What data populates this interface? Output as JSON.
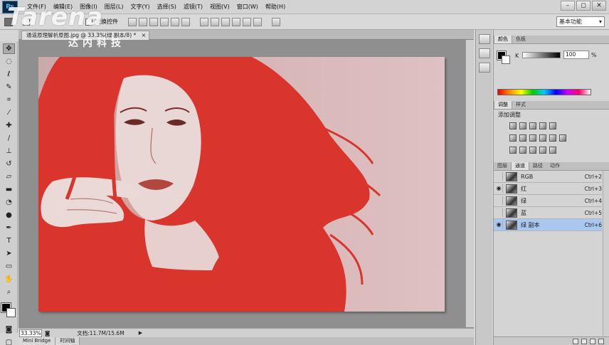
{
  "app": {
    "logo_text": "Ps",
    "menu": [
      "文件(F)",
      "编辑(E)",
      "图像(I)",
      "图层(L)",
      "文字(Y)",
      "选择(S)",
      "滤镜(T)",
      "视图(V)",
      "窗口(W)",
      "帮助(H)"
    ],
    "window_controls": [
      "–",
      "◻",
      "✕"
    ]
  },
  "watermark": {
    "logo": "Tarena",
    "subtitle": "达内科技"
  },
  "options_bar": {
    "transform_label": "变换控件",
    "workspace": "基本功能"
  },
  "document": {
    "tab_title": "通道原理解析原图.jpg @ 33.3%(绿 副本/8) *",
    "tab_close": "×",
    "zoom": "33.33%",
    "doc_size": "文档:11.7M/15.6M",
    "status_arrow": "▶"
  },
  "bottom_tabs": [
    "Mini Bridge",
    "时间轴"
  ],
  "color_panel": {
    "tabs": [
      "颜色",
      "色板"
    ],
    "channel_label": "K",
    "value": "100",
    "unit": "%"
  },
  "adjustments_panel": {
    "tabs": [
      "调整",
      "样式"
    ],
    "title": "添加调整"
  },
  "channels_panel": {
    "tabs": [
      "图层",
      "通道",
      "路径",
      "动作"
    ],
    "rows": [
      {
        "name": "RGB",
        "shortcut": "Ctrl+2",
        "visible": false,
        "selected": false
      },
      {
        "name": "红",
        "shortcut": "Ctrl+3",
        "visible": true,
        "selected": false
      },
      {
        "name": "绿",
        "shortcut": "Ctrl+4",
        "visible": false,
        "selected": false
      },
      {
        "name": "蓝",
        "shortcut": "Ctrl+5",
        "visible": false,
        "selected": false
      },
      {
        "name": "绿 副本",
        "shortcut": "Ctrl+6",
        "visible": true,
        "selected": true
      }
    ]
  },
  "colors": {
    "overlay_red": "#d9352c",
    "canvas_bg": "#d8b7b8",
    "selection": "#aac7f0"
  }
}
